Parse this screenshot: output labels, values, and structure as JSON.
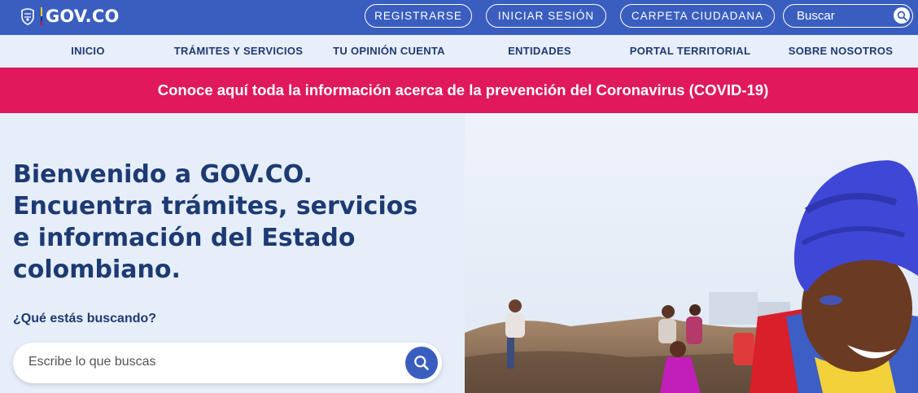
{
  "header": {
    "logo_text": "GOV.CO",
    "buttons": {
      "register": "REGISTRARSE",
      "login": "INICIAR SESIÓN",
      "citizen_folder": "CARPETA CIUDADANA"
    },
    "search": {
      "placeholder": "Buscar",
      "icon": "search-icon"
    }
  },
  "nav": {
    "items": [
      {
        "label": "INICIO"
      },
      {
        "label": "TRÁMITES Y SERVICIOS"
      },
      {
        "label": "TU OPINIÓN CUENTA"
      },
      {
        "label": "ENTIDADES"
      },
      {
        "label": "PORTAL TERRITORIAL"
      },
      {
        "label": "SOBRE NOSOTROS"
      }
    ]
  },
  "banner": {
    "text": "Conoce aquí toda la información acerca de la prevención del Coronavirus (COVID-19)"
  },
  "hero": {
    "title_lines": [
      "Bienvenido a GOV.CO.",
      "Encuentra trámites, servicios",
      "e información del Estado",
      "colombiano."
    ],
    "question": "¿Qué estás buscando?",
    "search": {
      "placeholder": "Escribe lo que buscas",
      "icon": "search-icon"
    }
  },
  "colors": {
    "topbar": "#3a5ebf",
    "nav_bg": "#e8eefa",
    "nav_text": "#1f3b73",
    "banner": "#e0185c",
    "hero_bg": "#e6eef9",
    "hero_text": "#1d3a73"
  }
}
